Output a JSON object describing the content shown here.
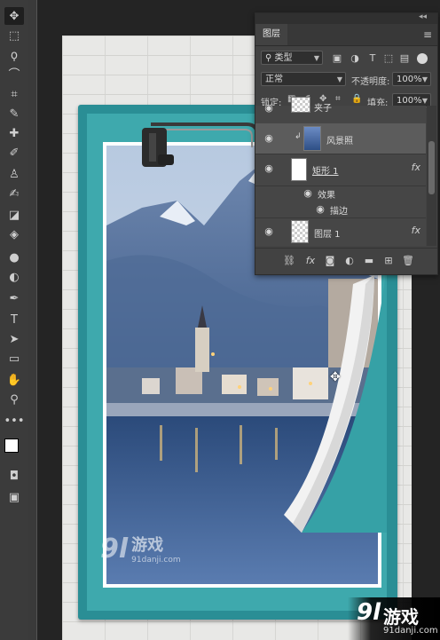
{
  "toolbar": {
    "tools": [
      {
        "name": "move-tool",
        "glyph": "✥"
      },
      {
        "name": "marquee-tool",
        "glyph": "⬚"
      },
      {
        "name": "lasso-tool",
        "glyph": "ϙ"
      },
      {
        "name": "quick-select-tool",
        "glyph": "⌒"
      },
      {
        "name": "crop-tool",
        "glyph": "⌗"
      },
      {
        "name": "eyedropper-tool",
        "glyph": "✎"
      },
      {
        "name": "healing-brush-tool",
        "glyph": "✚"
      },
      {
        "name": "brush-tool",
        "glyph": "✐"
      },
      {
        "name": "clone-stamp-tool",
        "glyph": "♙"
      },
      {
        "name": "history-brush-tool",
        "glyph": "✍"
      },
      {
        "name": "eraser-tool",
        "glyph": "◪"
      },
      {
        "name": "paint-bucket-tool",
        "glyph": "◈"
      },
      {
        "name": "blur-tool",
        "glyph": "●"
      },
      {
        "name": "dodge-tool",
        "glyph": "◐"
      },
      {
        "name": "pen-tool",
        "glyph": "✒"
      },
      {
        "name": "type-tool",
        "glyph": "T"
      },
      {
        "name": "path-select-tool",
        "glyph": "➤"
      },
      {
        "name": "rectangle-tool",
        "glyph": "▭"
      },
      {
        "name": "hand-tool",
        "glyph": "✋"
      },
      {
        "name": "zoom-tool",
        "glyph": "⚲"
      },
      {
        "name": "more-tools",
        "glyph": "•••"
      }
    ]
  },
  "layers_panel": {
    "tab_label": "图层",
    "filter_kind": "类型",
    "blend_mode": "正常",
    "opacity_label": "不透明度:",
    "opacity_value": "100%",
    "lock_label": "锁定:",
    "fill_label": "填充:",
    "fill_value": "100%",
    "layers": [
      {
        "name": "夹子",
        "selected": false
      },
      {
        "name": "风景照",
        "selected": true
      },
      {
        "name": "矩形 1",
        "selected": false,
        "fx": "fx"
      },
      {
        "name": "效果",
        "selected": false
      },
      {
        "name": "描边",
        "selected": false
      },
      {
        "name": "图层 1",
        "selected": false,
        "fx": "fx"
      }
    ]
  },
  "watermarks": {
    "center_logo": "9l",
    "center_name": "游戏",
    "center_url": "91danji.com",
    "corner_logo": "9l",
    "corner_name": "游戏",
    "corner_url": "91danji.com"
  },
  "colors": {
    "frame_teal": "#2a8e95",
    "frame_inner_teal": "#3ea9ad",
    "panel_bg": "#424242",
    "toolbar_bg": "#3b3b3b"
  }
}
